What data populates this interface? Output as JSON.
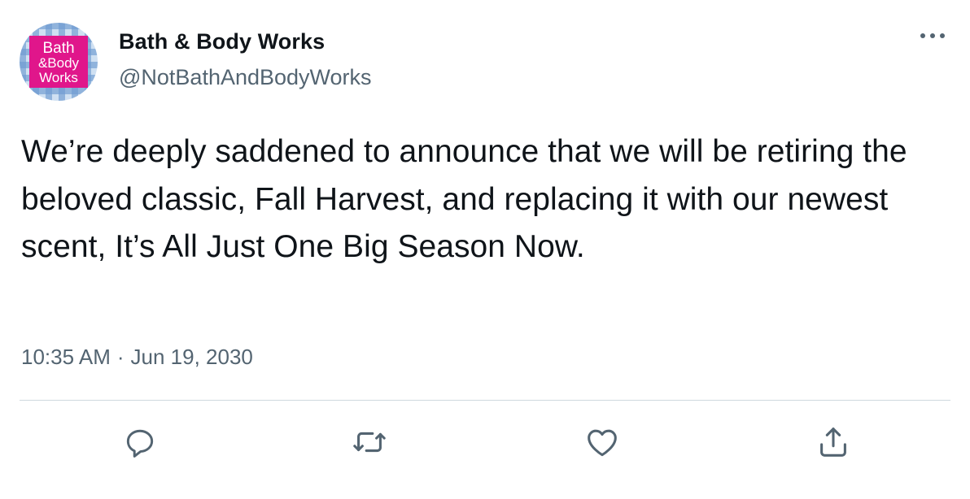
{
  "tweet": {
    "author": {
      "display_name": "Bath & Body Works",
      "handle": "@NotBathAndBodyWorks",
      "avatar_logo_text": [
        "Bath",
        "&Body",
        "Works"
      ]
    },
    "text": "We’re deeply saddened to announce that we will be retiring the beloved classic, Fall Harvest, and replacing it with our newest scent, It’s All Just One Big Season Now.",
    "time": "10:35 AM",
    "separator": "·",
    "date": "Jun 19, 2030"
  },
  "actions": {
    "reply_icon": "reply-icon",
    "retweet_icon": "retweet-icon",
    "like_icon": "heart-icon",
    "share_icon": "share-icon",
    "more_icon": "more-horizontal-icon"
  },
  "colors": {
    "text_primary": "#0f1419",
    "text_secondary": "#536471",
    "divider": "#cfd9de",
    "logo_pink": "#e0168b",
    "logo_blue": "#4a7fc1"
  }
}
